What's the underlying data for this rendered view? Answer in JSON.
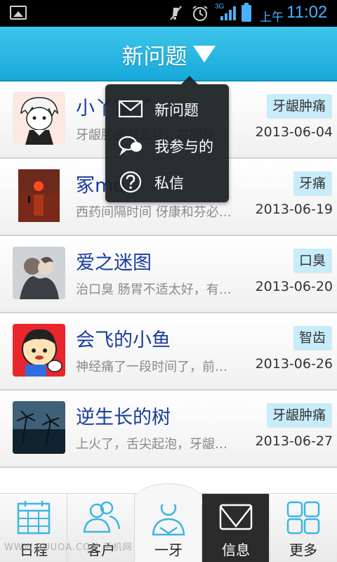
{
  "status_bar": {
    "network": "3G",
    "ampm": "上午",
    "time": "11:02",
    "accent_color": "#4ab0ff"
  },
  "header": {
    "title": "新问题",
    "caret_icon": "caret-down-icon",
    "color": "#18a9d9"
  },
  "popup_menu": {
    "items": [
      {
        "label": "新问题",
        "icon": "envelope-icon"
      },
      {
        "label": "我参与的",
        "icon": "chat-bubbles-icon"
      },
      {
        "label": "私信",
        "icon": "question-circle-icon"
      }
    ]
  },
  "questions": [
    {
      "name": "小丫富了",
      "snippet": "牙龈肿痛有血丝，右腮肿…",
      "date": "2013-06-04",
      "tag": "牙龈肿痛",
      "avatar": "anime-character-avatar"
    },
    {
      "name": "冢mo",
      "snippet": "西药间隔时间 伢康和芬必…",
      "date": "2013-06-19",
      "tag": "牙痛",
      "avatar": "sunset-avatar"
    },
    {
      "name": "爱之迷图",
      "snippet": "治口臭 肠胃不适太好，有…",
      "date": "2013-06-20",
      "tag": "口臭",
      "avatar": "couple-photo-avatar"
    },
    {
      "name": "会飞的小鱼",
      "snippet": "神经痛了一段时间了，前…",
      "date": "2013-06-26",
      "tag": "智齿",
      "avatar": "cartoon-kid-avatar"
    },
    {
      "name": "逆生长的树",
      "snippet": "上火了，舌尖起泡，牙龈…",
      "date": "2013-06-27",
      "tag": "牙龈肿痛",
      "avatar": "palm-trees-avatar"
    }
  ],
  "bottom_nav": {
    "items": [
      {
        "label": "日程",
        "icon": "calendar-icon"
      },
      {
        "label": "客户",
        "icon": "group-icon"
      },
      {
        "label": "一牙",
        "icon": "user-icon"
      },
      {
        "label": "信息",
        "icon": "envelope-icon"
      },
      {
        "label": "更多",
        "icon": "grid-icon"
      }
    ],
    "active": "信息"
  },
  "watermark": "WWW.BUUOA.COM 手机网"
}
